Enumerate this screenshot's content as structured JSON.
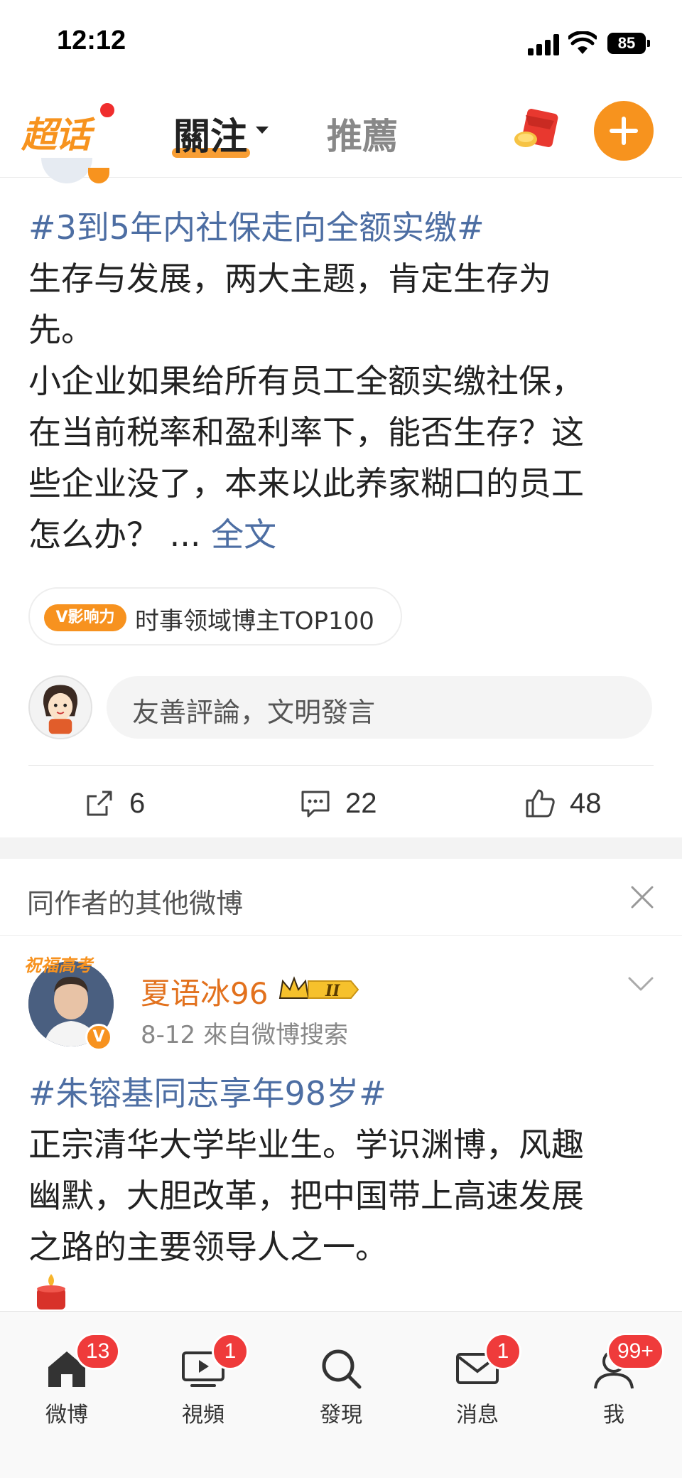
{
  "status_bar": {
    "time": "12:12",
    "battery": "85"
  },
  "top_nav": {
    "chaohua_label": "超话",
    "tab_follow": "關注",
    "tab_recommend": "推薦"
  },
  "post1": {
    "topic": "#3到5年内社保走向全额实缴#",
    "body_lines": [
      "生存与发展，两大主题，肯定生存为",
      "先。",
      "小企业如果给所有员工全额实缴社保，",
      "在当前税率和盈利率下，能否生存？这",
      "些企业没了，本来以此养家糊口的员工"
    ],
    "last_line": "怎么办？ ...",
    "fulltext_link": "全文",
    "influence_tag": "V影响力",
    "influence_text": "时事领域博主TOP100",
    "comment_placeholder": "友善評論，文明發言",
    "actions": {
      "share_count": "6",
      "comment_count": "22",
      "like_count": "48"
    }
  },
  "more_from_author": {
    "title": "同作者的其他微博"
  },
  "post2": {
    "avatar_banner": "祝福高考",
    "author_name": "夏语冰96",
    "level_badge": "II",
    "meta": "8-12  來自微博搜索",
    "topic": "#朱镕基同志享年98岁#",
    "body_lines": [
      "正宗清华大学毕业生。学识渊博，风趣",
      "幽默，大胆改革，把中国带上高速发展",
      "之路的主要领导人之一。"
    ]
  },
  "tab_bar": {
    "items": [
      {
        "label": "微博",
        "badge": "13"
      },
      {
        "label": "視頻",
        "badge": "1"
      },
      {
        "label": "發現",
        "badge": ""
      },
      {
        "label": "消息",
        "badge": "1"
      },
      {
        "label": "我",
        "badge": "99+"
      }
    ]
  },
  "colors": {
    "accent": "#f7931e",
    "link": "#4d6ea3",
    "badge_red": "#ef3b3b",
    "author_name": "#e2711d"
  }
}
